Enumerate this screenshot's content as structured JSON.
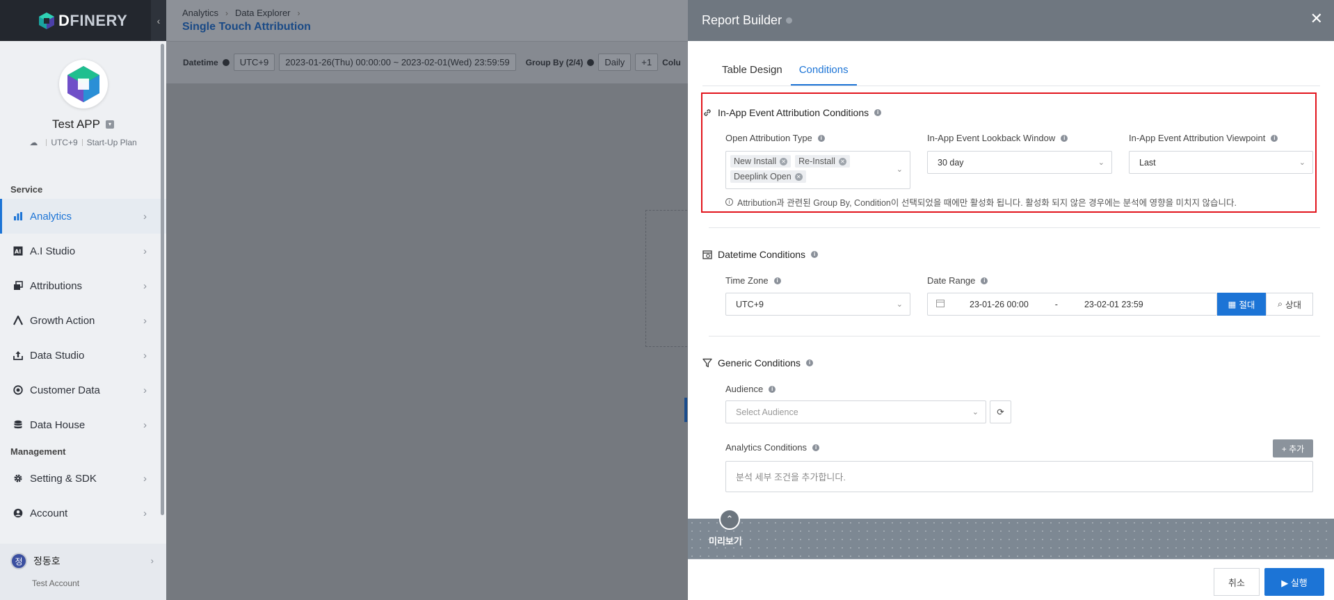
{
  "brand": {
    "logo_d": "D",
    "logo_rest": "FINERY",
    "collapse_icon": "chevron-left-icon"
  },
  "app": {
    "name": "Test APP",
    "timezone": "UTC+9",
    "plan": "Start-Up Plan"
  },
  "sidebar": {
    "service_label": "Service",
    "service_items": [
      {
        "label": "Analytics",
        "icon": "bar-chart-icon",
        "active": true
      },
      {
        "label": "A.I Studio",
        "icon": "ai-icon"
      },
      {
        "label": "Attributions",
        "icon": "attributions-icon"
      },
      {
        "label": "Growth Action",
        "icon": "growth-icon"
      },
      {
        "label": "Data Studio",
        "icon": "upload-icon"
      },
      {
        "label": "Customer Data",
        "icon": "target-icon"
      },
      {
        "label": "Data House",
        "icon": "database-icon"
      }
    ],
    "management_label": "Management",
    "management_items": [
      {
        "label": "Setting & SDK",
        "icon": "gear-icon"
      },
      {
        "label": "Account",
        "icon": "user-icon"
      }
    ],
    "user": {
      "initial": "정",
      "name": "정동호",
      "sub": "Test Account"
    }
  },
  "background": {
    "breadcrumb": [
      "Analytics",
      "Data Explorer"
    ],
    "page_title": "Single Touch Attribution",
    "filter": {
      "datetime_label": "Datetime",
      "timezone": "UTC+9",
      "range": "2023-01-26(Thu) 00:00:00 ~ 2023-02-01(Wed) 23:59:59",
      "group_by_label": "Group By (2/4)",
      "granularity": "Daily",
      "plus": "+1",
      "columns_label": "Colu"
    }
  },
  "panel": {
    "title": "Report Builder",
    "tabs": [
      "Table Design",
      "Conditions"
    ],
    "active_tab": 1,
    "inapp": {
      "title": "In-App Event Attribution Conditions",
      "open_type_label": "Open Attribution Type",
      "open_type_tags": [
        "New Install",
        "Re-Install",
        "Deeplink Open"
      ],
      "lookback_label": "In-App Event Lookback Window",
      "lookback_value": "30 day",
      "viewpoint_label": "In-App Event Attribution Viewpoint",
      "viewpoint_value": "Last",
      "notice": "Attribution과 관련된 Group By, Condition이 선택되었을 때에만 활성화 됩니다. 활성화 되지 않은 경우에는 분석에 영향을 미치지 않습니다."
    },
    "datetime": {
      "title": "Datetime Conditions",
      "timezone_label": "Time Zone",
      "timezone_value": "UTC+9",
      "range_label": "Date Range",
      "start": "23-01-26 00:00",
      "separator": "-",
      "end": "23-02-01 23:59",
      "absolute_label": "절대",
      "relative_label": "상대"
    },
    "generic": {
      "title": "Generic Conditions",
      "audience_label": "Audience",
      "audience_placeholder": "Select Audience",
      "analytics_label": "Analytics Conditions",
      "add_label": "+ 추가",
      "analytics_placeholder": "분석 세부 조건을 추가합니다."
    },
    "preview_label": "미리보기",
    "cancel_label": "취소",
    "run_label": "▶ 실행"
  },
  "colors": {
    "accent": "#1c74d6",
    "highlight": "#e2141c",
    "sidebar_dark": "#23272e",
    "panel_header": "#6f7780"
  }
}
